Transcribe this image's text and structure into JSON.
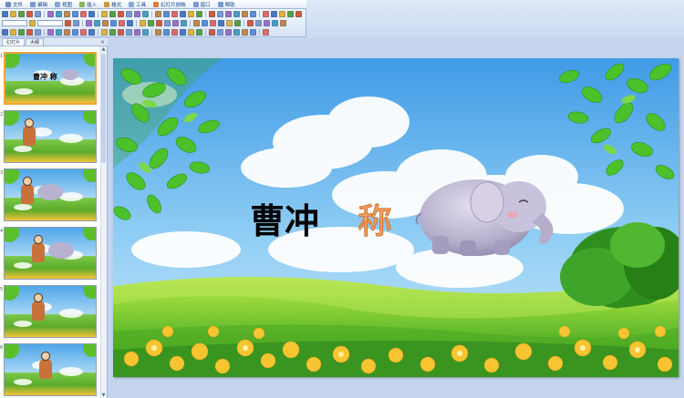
{
  "menubar": {
    "items": [
      {
        "label": "文件",
        "color": "#6b8fc5"
      },
      {
        "label": "编辑",
        "color": "#7a9ad0"
      },
      {
        "label": "视图",
        "color": "#8aa6d8"
      },
      {
        "label": "插入",
        "color": "#8ab35b"
      },
      {
        "label": "格式",
        "color": "#c79b3b"
      },
      {
        "label": "工具",
        "color": "#8aa6d8"
      },
      {
        "label": "幻灯片放映",
        "color": "#d9803a"
      },
      {
        "label": "窗口",
        "color": "#7a9ad0"
      },
      {
        "label": "帮助",
        "color": "#7a9ad0"
      }
    ]
  },
  "side_panel": {
    "tabs": [
      {
        "label": "幻灯片",
        "active": true
      },
      {
        "label": "大纲",
        "active": false
      }
    ],
    "close_glyph": "×"
  },
  "slide": {
    "title": "曹冲",
    "title_accent": "称",
    "accent_color": "#f2a86b",
    "title_color": "#000000"
  },
  "thumbnails": [
    {
      "num": "1",
      "selected": true,
      "text": "曹冲 称"
    },
    {
      "num": "2",
      "selected": false,
      "text": ""
    },
    {
      "num": "3",
      "selected": false,
      "text": ""
    },
    {
      "num": "4",
      "selected": false,
      "text": ""
    },
    {
      "num": "5",
      "selected": false,
      "text": ""
    },
    {
      "num": "6",
      "selected": false,
      "text": ""
    }
  ],
  "icons": {
    "scroll_up": "▲",
    "scroll_down": "▼"
  }
}
